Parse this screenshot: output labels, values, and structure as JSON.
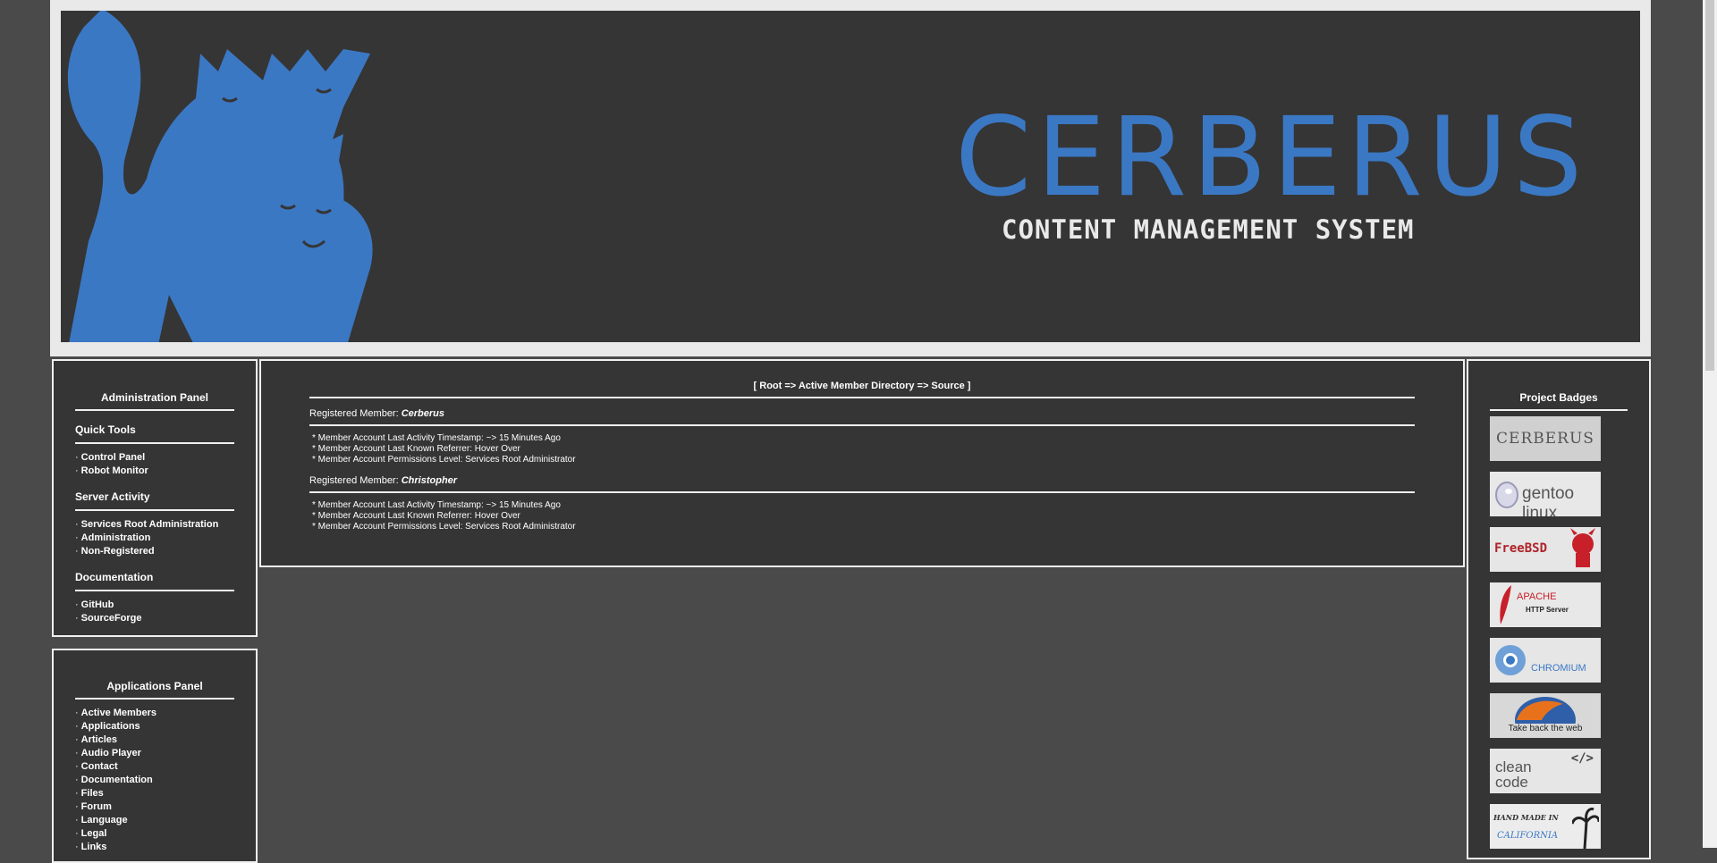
{
  "header": {
    "logo_title": "CERBERUS",
    "logo_subtitle": "CONTENT MANAGEMENT SYSTEM",
    "accent_color": "#3b78c4"
  },
  "admin_panel": {
    "title": "Administration Panel",
    "sections": [
      {
        "heading": "Quick Tools",
        "items": [
          "Control Panel",
          "Robot Monitor"
        ]
      },
      {
        "heading": "Server Activity",
        "items": [
          "Services Root Administration",
          "Administration",
          "Non-Registered"
        ]
      },
      {
        "heading": "Documentation",
        "items": [
          "GitHub",
          "SourceForge"
        ]
      }
    ]
  },
  "apps_panel": {
    "title": "Applications Panel",
    "items": [
      "Active Members",
      "Applications",
      "Articles",
      "Audio Player",
      "Contact",
      "Documentation",
      "Files",
      "Forum",
      "Language",
      "Legal",
      "Links"
    ]
  },
  "content": {
    "breadcrumb": "[ Root => Active Member Directory => Source ]",
    "member_prefix": "Registered Member: ",
    "members": [
      {
        "name": "Cerberus",
        "lines": [
          "* Member Account Last Activity Timestamp: ~> 15 Minutes Ago",
          "* Member Account Last Known Referrer: Hover Over",
          "* Member Account Permissions Level: Services Root Administrator"
        ]
      },
      {
        "name": "Christopher",
        "lines": [
          "* Member Account Last Activity Timestamp: ~> 15 Minutes Ago",
          "* Member Account Last Known Referrer: Hover Over",
          "* Member Account Permissions Level: Services Root Administrator"
        ]
      }
    ]
  },
  "badges_panel": {
    "title": "Project Badges",
    "badges": [
      {
        "text": "CERBERUS",
        "icon": "cerberus-badge"
      },
      {
        "text": "gentoo linux",
        "icon": "gentoo-badge"
      },
      {
        "text": "FreeBSD",
        "icon": "freebsd-badge"
      },
      {
        "text": "APACHE",
        "text2": "HTTP Server",
        "icon": "apache-badge"
      },
      {
        "text": "CHROMIUM",
        "icon": "chromium-badge"
      },
      {
        "text": "Take back the web",
        "icon": "firefox-badge"
      },
      {
        "text": "clean code",
        "icon": "clean-code-badge"
      },
      {
        "text": "HAND MADE IN",
        "text2": "CALIFORNIA",
        "icon": "california-badge"
      }
    ]
  }
}
